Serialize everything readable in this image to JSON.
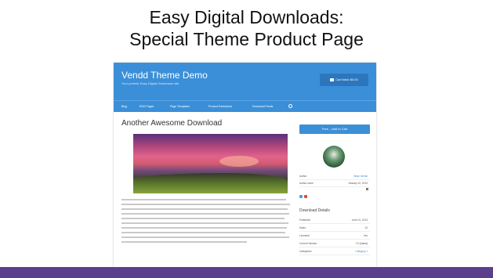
{
  "slide": {
    "title_line1": "Easy Digital Downloads:",
    "title_line2": "Special Theme Product Page",
    "accent_color": "#5b3f8c"
  },
  "screenshot": {
    "header": {
      "site_title": "Vendd Theme Demo",
      "tagline": "Your premier Easy Digital Downloads site",
      "cart_label": "Cart total: $0.00",
      "header_color": "#3b8fd8"
    },
    "nav": {
      "items": [
        "Blog",
        "EDD Pages",
        "Page Templates",
        "Product Extensions",
        "Download Feeds"
      ],
      "search_icon": "search-icon"
    },
    "main": {
      "page_heading": "Another Awesome Download"
    },
    "sidebar": {
      "purchase_label": "Free – Add to Cart",
      "meta_rows": [
        {
          "label": "Author",
          "value": "Brian Gerski"
        },
        {
          "label": "Author since",
          "value": "January 10, 2013"
        }
      ],
      "details_heading": "Download Details",
      "details_rows": [
        {
          "label": "Published",
          "value": "June 01, 2013"
        },
        {
          "label": "Sales",
          "value": "10"
        },
        {
          "label": "Licensed",
          "value": "Yes"
        },
        {
          "label": "Current Version",
          "value": "2.0 (latest)"
        },
        {
          "label": "Categories",
          "value": "Category 1"
        }
      ]
    }
  }
}
